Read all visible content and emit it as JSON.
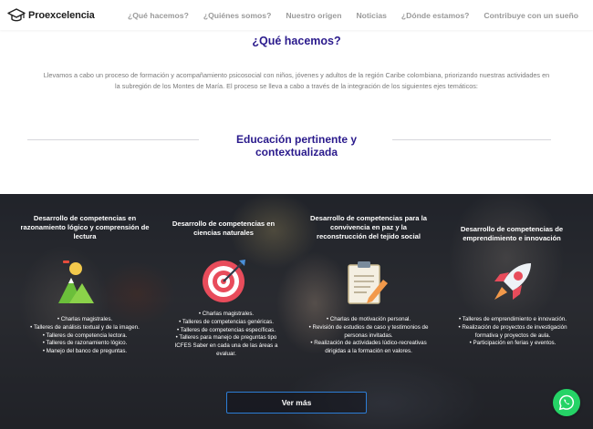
{
  "brand": {
    "name": "Proexcelencia"
  },
  "nav": {
    "links": [
      "¿Qué hacemos?",
      "¿Quiénes somos?",
      "Nuestro origen",
      "Noticias",
      "¿Dónde estamos?",
      "Contribuye con un sueño"
    ]
  },
  "intro": {
    "title": "¿Qué hacemos?",
    "paragraph": "Llevamos a cabo un proceso de formación y acompañamiento psicosocial con niños, jóvenes y adultos de la región Caribe colombiana, priorizando nuestras actividades en la subregión de los Montes de María. El proceso se lleva a cabo a través de la integración de los siguientes ejes temáticos:",
    "subtitle": "Educación pertinente y contextualizada"
  },
  "axes": [
    {
      "title": "Desarrollo de competencias en razonamiento lógico y comprensión de lectura",
      "icon": "hills-icon",
      "items": [
        "Charlas magistrales.",
        "Talleres de análisis textual y de la imagen.",
        "Talleres de competencia lectora.",
        "Talleres de razonamiento lógico.",
        "Manejo del banco de preguntas."
      ]
    },
    {
      "title": "Desarrollo de competencias en ciencias naturales",
      "icon": "target-icon",
      "items": [
        "Charlas magistrales.",
        "Talleres de competencias genéricas.",
        "Talleres de competencias específicas.",
        "Talleres para manejo de preguntas tipo ICFES Saber en cada una de las áreas a evaluar."
      ]
    },
    {
      "title": "Desarrollo de competencias para la convivencia en paz y la reconstrucción del tejido social",
      "icon": "clipboard-icon",
      "items": [
        "Charlas de motivación personal.",
        "Revisión de estudios de caso y testimonios de personas invitadas.",
        "Realización de actividades lúdico-recreativas dirigidas a la formación en valores."
      ]
    },
    {
      "title": "Desarrollo de competencias de emprendimiento e innovación",
      "icon": "rocket-icon",
      "items": [
        "Talleres de emprendimiento e innovación.",
        "Realización de proyectos de investigación formativa y proyectos de aula.",
        "Participación en ferias y eventos."
      ]
    }
  ],
  "cta": {
    "label": "Ver más"
  },
  "colors": {
    "brand_title": "#2a1a8c",
    "button_border": "#2c7dd6",
    "whatsapp": "#25d366"
  }
}
